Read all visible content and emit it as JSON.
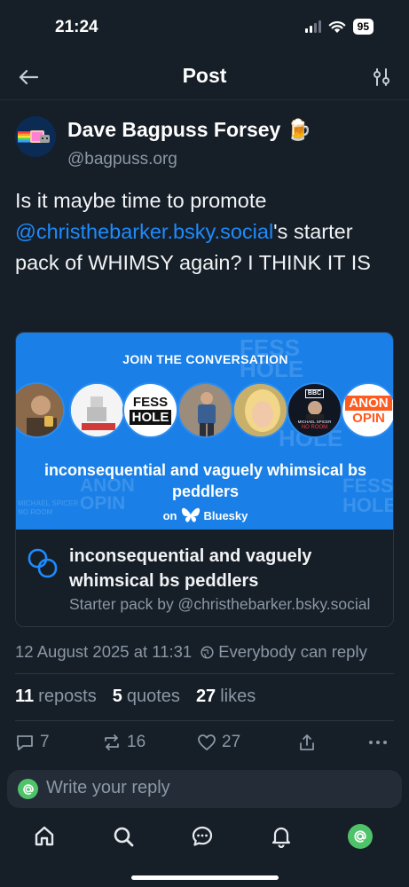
{
  "status_bar": {
    "time": "21:24",
    "battery": "95"
  },
  "header": {
    "title": "Post",
    "back_icon": "arrow-left-icon",
    "filter_icon": "sliders-icon"
  },
  "post": {
    "author_name": "Dave Bagpuss Forsey 🍺",
    "author_handle": "@bagpuss.org",
    "text_before": "Is it maybe time to promote ",
    "mention": "@christhebarker.bsky.social",
    "text_after": "'s starter pack of WHIMSY again? I THINK IT IS"
  },
  "embed": {
    "kicker": "JOIN THE CONVERSATION",
    "banner_title": "inconsequential and vaguely whimsical bs peddlers",
    "brand_prefix": "on",
    "brand_name": "Bluesky",
    "pack_title": "inconsequential and vaguely whimsical bs peddlers",
    "pack_subtitle": "Starter pack by @christhebarker.bsky.social",
    "face_labels": {
      "fess_top": "FESS",
      "fess_bottom": "HOLE",
      "bbc": "BBC",
      "michael_spicer": "MICHAEL SPICER",
      "no_room": "NO ROOM",
      "anon": "ANON",
      "opin": "OPIN"
    },
    "bg_text": {
      "fess": "FESS",
      "hole": "HOLE",
      "anon": "ANON",
      "opin": "OPIN",
      "spicer": "MICHAEL SPICER",
      "no_room": "NO ROOM"
    }
  },
  "meta": {
    "timestamp": "12 August 2025 at 11:31",
    "reply_setting": "Everybody can reply"
  },
  "counts": {
    "reposts": {
      "value": "11",
      "label": "reposts"
    },
    "quotes": {
      "value": "5",
      "label": "quotes"
    },
    "likes": {
      "value": "27",
      "label": "likes"
    }
  },
  "actions": {
    "replies": "7",
    "reposts": "16",
    "likes": "27"
  },
  "reply_box": {
    "placeholder": "Write your reply"
  },
  "colors": {
    "background": "#161e27",
    "accent": "#1d8cff",
    "banner": "#1a7fe6"
  }
}
